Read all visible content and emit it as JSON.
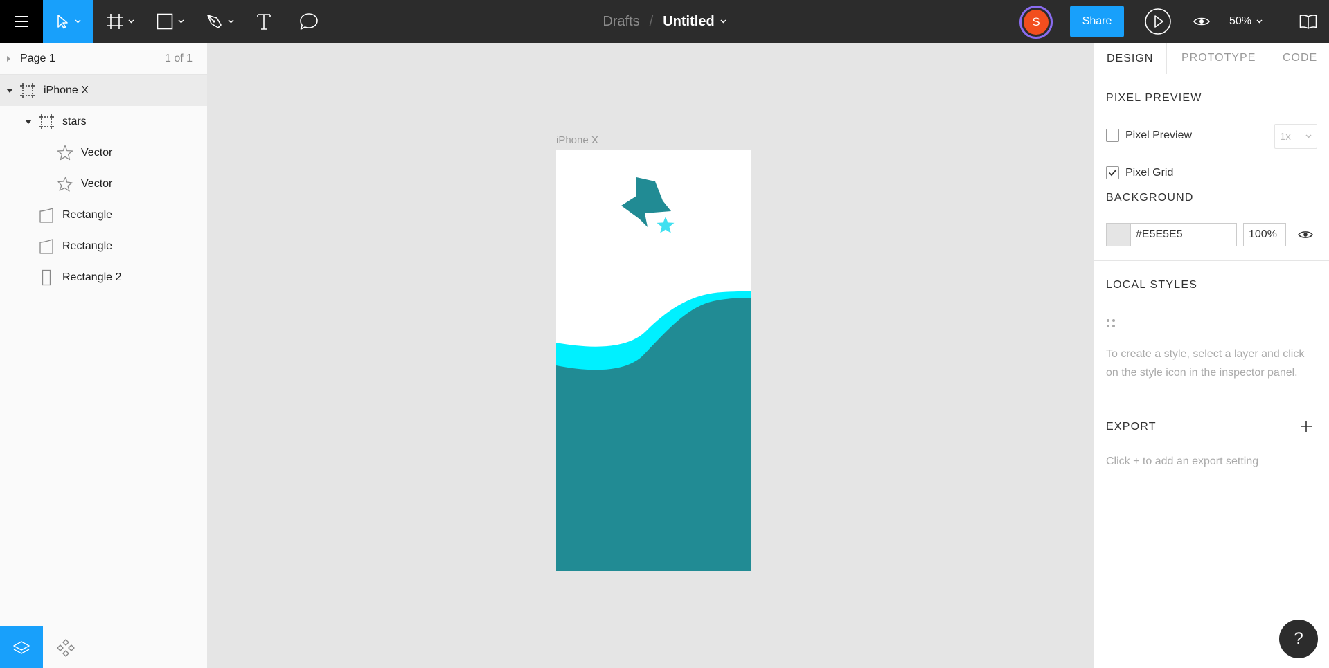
{
  "toolbar": {
    "icons": [
      "menu-icon",
      "move-icon",
      "frame-icon",
      "rectangle-icon",
      "pen-icon",
      "text-icon",
      "comment-icon",
      "play-icon",
      "eye-icon",
      "book-icon"
    ],
    "breadcrumb": {
      "project": "Drafts",
      "separator": "/",
      "file": "Untitled"
    },
    "avatar_initial": "S",
    "share_label": "Share",
    "zoom": "50%"
  },
  "pages": {
    "current": "Page 1",
    "count": "1 of 1"
  },
  "layers": [
    {
      "name": "iPhone X",
      "type": "frame",
      "depth": 0,
      "expanded": true,
      "selected": true
    },
    {
      "name": "stars",
      "type": "frame",
      "depth": 1,
      "expanded": true
    },
    {
      "name": "Vector",
      "type": "star",
      "depth": 2
    },
    {
      "name": "Vector",
      "type": "star",
      "depth": 2
    },
    {
      "name": "Rectangle",
      "type": "rectangle",
      "depth": 1
    },
    {
      "name": "Rectangle",
      "type": "rectangle",
      "depth": 1
    },
    {
      "name": "Rectangle 2",
      "type": "rectangle",
      "depth": 1
    }
  ],
  "canvas": {
    "frame_name": "iPhone X",
    "colors": {
      "teal": "#218b94",
      "cyan": "#00f0ff",
      "light_cyan": "#40e0f0",
      "white": "#ffffff"
    }
  },
  "inspector": {
    "tabs": [
      "DESIGN",
      "PROTOTYPE",
      "CODE"
    ],
    "active_tab": "DESIGN",
    "pixel_preview": {
      "title": "PIXEL PREVIEW",
      "preview_label": "Pixel Preview",
      "preview_checked": false,
      "grid_label": "Pixel Grid",
      "grid_checked": true,
      "scale": "1x"
    },
    "background": {
      "title": "BACKGROUND",
      "hex": "#E5E5E5",
      "opacity": "100%"
    },
    "local_styles": {
      "title": "LOCAL STYLES",
      "hint": "To create a style, select a layer and click on the style icon in the inspector panel."
    },
    "export": {
      "title": "EXPORT",
      "hint": "Click + to add an export setting"
    }
  },
  "help_label": "?",
  "accent": "#18a0fb"
}
